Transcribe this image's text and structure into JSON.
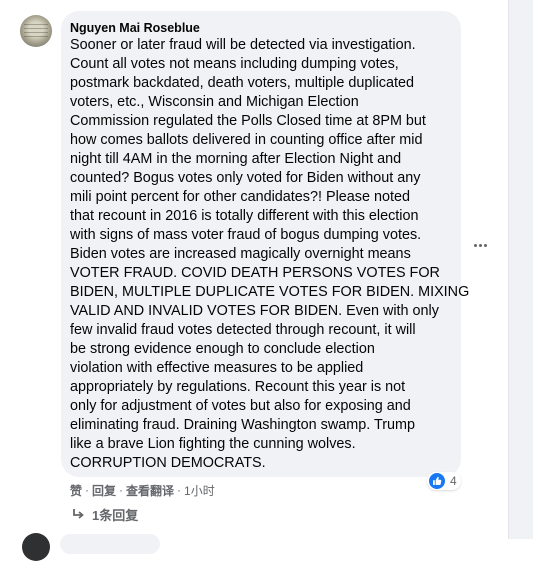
{
  "comment": {
    "author": "Nguyen Mai Roseblue",
    "lines": [
      "Sooner or later fraud will be detected via investigation.",
      "Count all votes not means including dumping votes,",
      "postmark backdated, death voters, multiple duplicated",
      "voters, etc., Wisconsin and Michigan Election",
      "Commission regulated the Polls Closed time at 8PM but",
      "how comes ballots delivered in counting office after mid",
      "night till 4AM in the morning after Election Night and",
      "counted? Bogus votes only voted for Biden without any",
      "mili point percent for other candidates?! Please noted",
      "that recount in 2016 is totally different with this election",
      "with signs of mass voter fraud of bogus dumping votes.",
      "Biden votes are increased magically overnight means",
      "VOTER FRAUD. COVID DEATH PERSONS VOTES FOR",
      "BIDEN, MULTIPLE DUPLICATE VOTES FOR BIDEN. MIXING",
      "VALID AND INVALID VOTES FOR BIDEN. Even with only",
      "few invalid fraud votes detected through recount, it will",
      "be strong evidence enough to conclude election",
      "violation with effective measures to be applied",
      "appropriately by regulations. Recount this year is not",
      "only for adjustment of votes but also for exposing and",
      "eliminating fraud. Draining Washington swamp. Trump",
      "like a brave Lion fighting the cunning wolves.",
      "CORRUPTION DEMOCRATS."
    ],
    "reaction": {
      "type": "like",
      "count": "4",
      "color": "#1877f2"
    },
    "actions": {
      "like": "赞",
      "reply": "回复",
      "translate": "查看翻译",
      "timestamp": "1小时"
    },
    "replies_label": "1条回复",
    "more_icon": "ellipsis-icon"
  },
  "colors": {
    "bubble": "#f0f2f5",
    "text": "#050505",
    "secondary": "#65676b",
    "accent": "#1877f2"
  }
}
